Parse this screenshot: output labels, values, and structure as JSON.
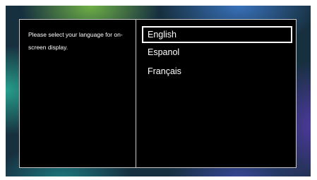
{
  "dialog": {
    "prompt": "Please select your language for on-screen display.",
    "languages": [
      {
        "label": "English",
        "selected": true
      },
      {
        "label": "Espanol",
        "selected": false
      },
      {
        "label": "Français",
        "selected": false
      }
    ]
  },
  "colors": {
    "panel_background": "#000000",
    "text": "#ffffff",
    "divider": "#c9c9c9",
    "selection_border": "#ffffff"
  }
}
